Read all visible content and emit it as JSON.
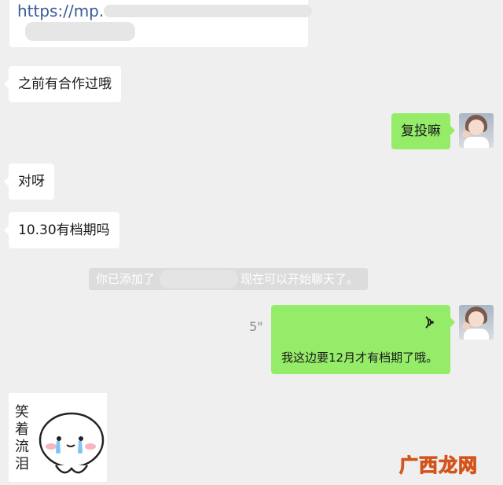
{
  "messages": {
    "link_text": "https://mp.w",
    "msg1": "之前有合作过哦",
    "msg2": "复投嘛",
    "msg3": "对呀",
    "msg4": "10.30有档期吗",
    "system_prefix": "你已添加了",
    "system_suffix": "现在可以开始聊天了。",
    "voice_duration": "5\"",
    "voice_transcript": "我这边要12月才有档期了哦。",
    "sticker_text": "笑着流泪"
  },
  "watermark": "广西龙网",
  "colors": {
    "background": "#efefef",
    "incoming_bubble": "#ffffff",
    "outgoing_bubble": "#95ec69",
    "system_notice": "#dcdcdc"
  },
  "icons": {
    "voice": "voice-wave-icon",
    "avatar": "user-avatar"
  }
}
